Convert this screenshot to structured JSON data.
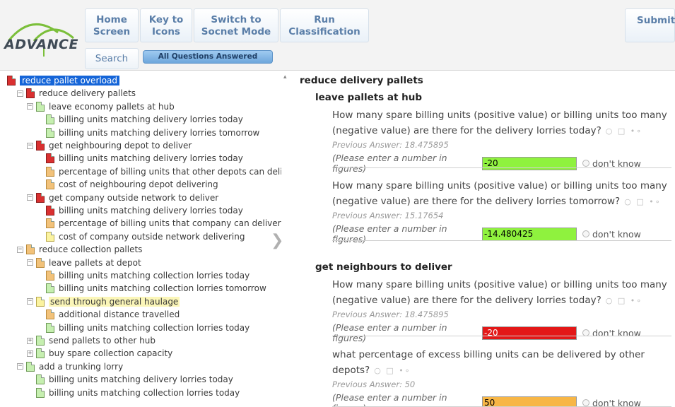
{
  "header": {
    "logo_text": "ADVANCE",
    "nav": {
      "home": "Home Screen",
      "key": "Key to Icons",
      "socnet": "Switch to Socnet Mode",
      "run": "Run Classification",
      "submit": "Submit"
    },
    "search_label": "Search",
    "status_label": "All Questions Answered"
  },
  "tree": {
    "nodes": [
      {
        "label": "reduce pallet overload",
        "icon": "red",
        "state": "selected"
      },
      {
        "label": "reduce delivery pallets",
        "icon": "red",
        "toggle": "−"
      },
      {
        "label": "leave economy pallets at hub",
        "icon": "green",
        "toggle": "−"
      },
      {
        "label": "billing units matching delivery lorries today",
        "icon": "green"
      },
      {
        "label": "billing units matching delivery lorries tomorrow",
        "icon": "green"
      },
      {
        "label": "get neighbouring depot to deliver",
        "icon": "red",
        "toggle": "−"
      },
      {
        "label": "billing units matching delivery lorries today",
        "icon": "red"
      },
      {
        "label": "percentage of billing units that other depots can deliver",
        "icon": "orange"
      },
      {
        "label": "cost of neighbouring depot delivering",
        "icon": "orange"
      },
      {
        "label": "get company outside network to deliver",
        "icon": "red",
        "toggle": "−"
      },
      {
        "label": "billing units matching delivery lorries today",
        "icon": "red"
      },
      {
        "label": "percentage of billing units that company can deliver",
        "icon": "orange"
      },
      {
        "label": "cost of company outside network delivering",
        "icon": "yellow"
      },
      {
        "label": "reduce collection pallets",
        "icon": "orange",
        "toggle": "−"
      },
      {
        "label": "leave pallets at depot",
        "icon": "orange",
        "toggle": "−"
      },
      {
        "label": "billing units matching collection lorries today",
        "icon": "orange"
      },
      {
        "label": "billing units matching collection lorries tomorrow",
        "icon": "green"
      },
      {
        "label": "send through general haulage",
        "icon": "yellow",
        "toggle": "−",
        "state": "hovered"
      },
      {
        "label": "additional distance travelled",
        "icon": "orange"
      },
      {
        "label": "billing units matching collection lorries today",
        "icon": "green"
      },
      {
        "label": "send pallets to other hub",
        "icon": "green",
        "toggle": "+"
      },
      {
        "label": "buy spare collection capacity",
        "icon": "green",
        "toggle": "+"
      },
      {
        "label": "add a trunking lorry",
        "icon": "green",
        "toggle": "−"
      },
      {
        "label": "billing units matching delivery lorries today",
        "icon": "green"
      },
      {
        "label": "billing units matching collection lorries today",
        "icon": "green"
      }
    ]
  },
  "main": {
    "title": "reduce delivery pallets",
    "sections": [
      {
        "title": "leave pallets at hub",
        "questions": [
          {
            "text": "How many spare billing units (positive value) or billing units too many (negative value) are there for the delivery lorries today?",
            "previous": "Previous Answer: 18.475895",
            "hint": "(Please enter a number in figures)",
            "answer": "-20",
            "answer_color": "green",
            "dont_know": "don't know"
          },
          {
            "text": "How many spare billing units (positive value) or billing units too many (negative value) are there for the delivery lorries tomorrow?",
            "previous": "Previous Answer: 15.17654",
            "hint": "(Please enter a number in figures)",
            "answer": "-14.480425",
            "answer_color": "green",
            "dont_know": "don't know"
          }
        ]
      },
      {
        "title": "get neighbours to deliver",
        "questions": [
          {
            "text": "How many spare billing units (positive value) or billing units too many (negative value) are there for the delivery lorries today?",
            "previous": "Previous Answer: 18.475895",
            "hint": "(Please enter a number in figures)",
            "answer": "-20",
            "answer_color": "red",
            "dont_know": "don't know"
          },
          {
            "text": "what percentage of excess billing units can be delivered by other depots?",
            "previous": "Previous Answer: 50",
            "hint": "(Please enter a number in figures)",
            "answer": "50",
            "answer_color": "orange",
            "dont_know": "don't know"
          }
        ]
      }
    ]
  }
}
